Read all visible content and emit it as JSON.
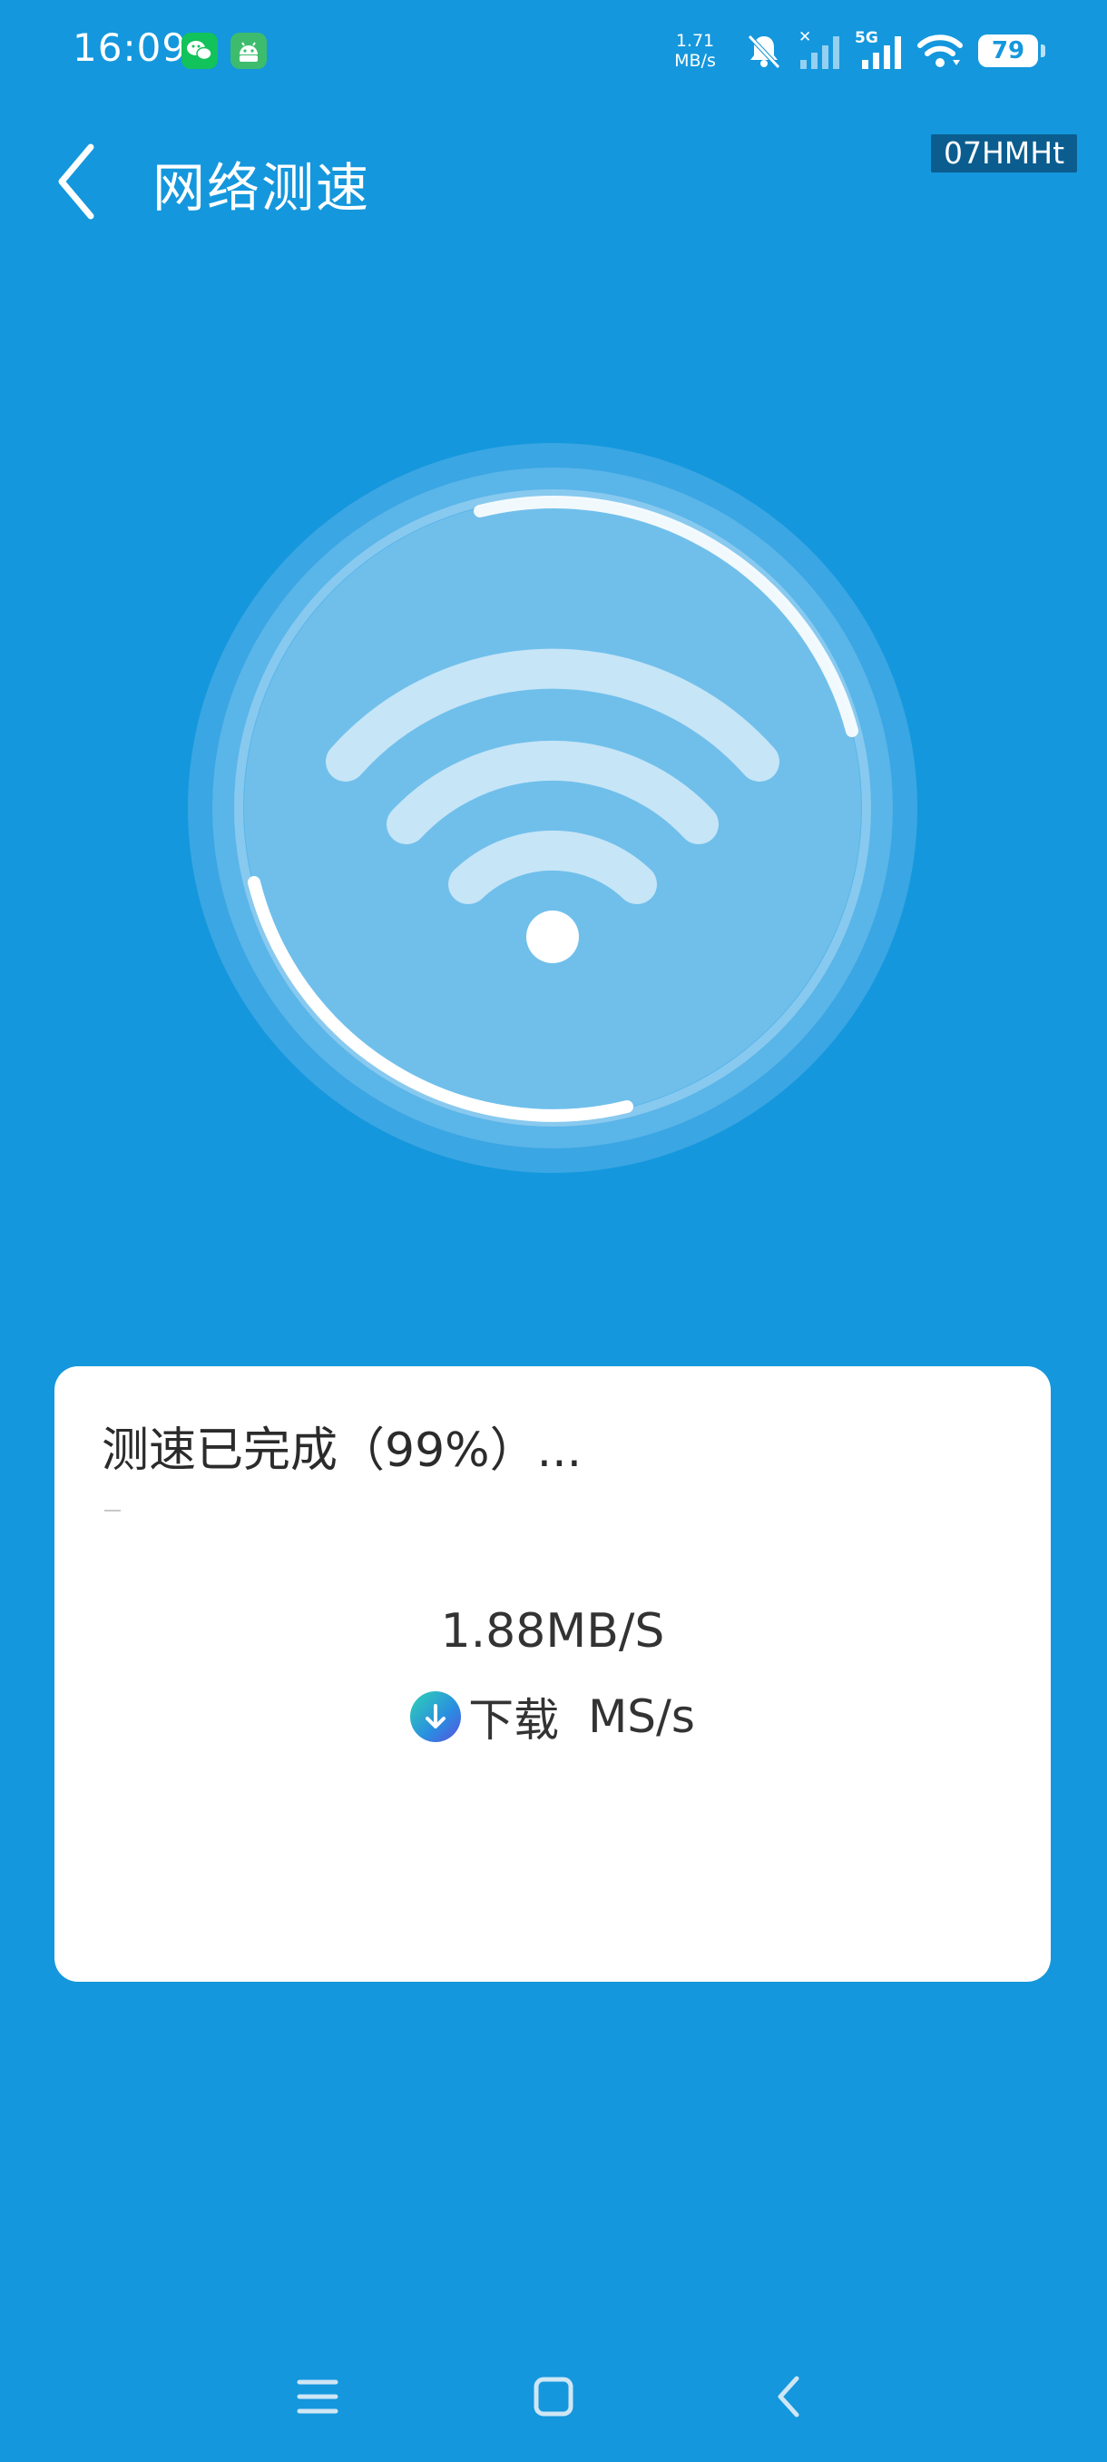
{
  "status_bar": {
    "time": "16:09",
    "net_speed_value": "1.71",
    "net_speed_unit": "MB/s",
    "network_type": "5G",
    "battery": "79",
    "icons": [
      "wechat-icon",
      "android-icon",
      "mute-icon",
      "signal-icon",
      "wifi-icon",
      "battery-icon"
    ]
  },
  "header": {
    "title": "网络测速",
    "tag": "07HMHt"
  },
  "dial": {
    "icon": "wifi-icon"
  },
  "result": {
    "status_text": "测速已完成（99%）...",
    "speed": "1.88MB/S",
    "download_label": "下载",
    "download_unit": "MS/s"
  },
  "nav_bar": {
    "icons": [
      "menu-icon",
      "home-icon",
      "back-icon"
    ]
  },
  "colors": {
    "background": "#1497dd",
    "card": "#ffffff",
    "tag": "#0b5d8f"
  }
}
